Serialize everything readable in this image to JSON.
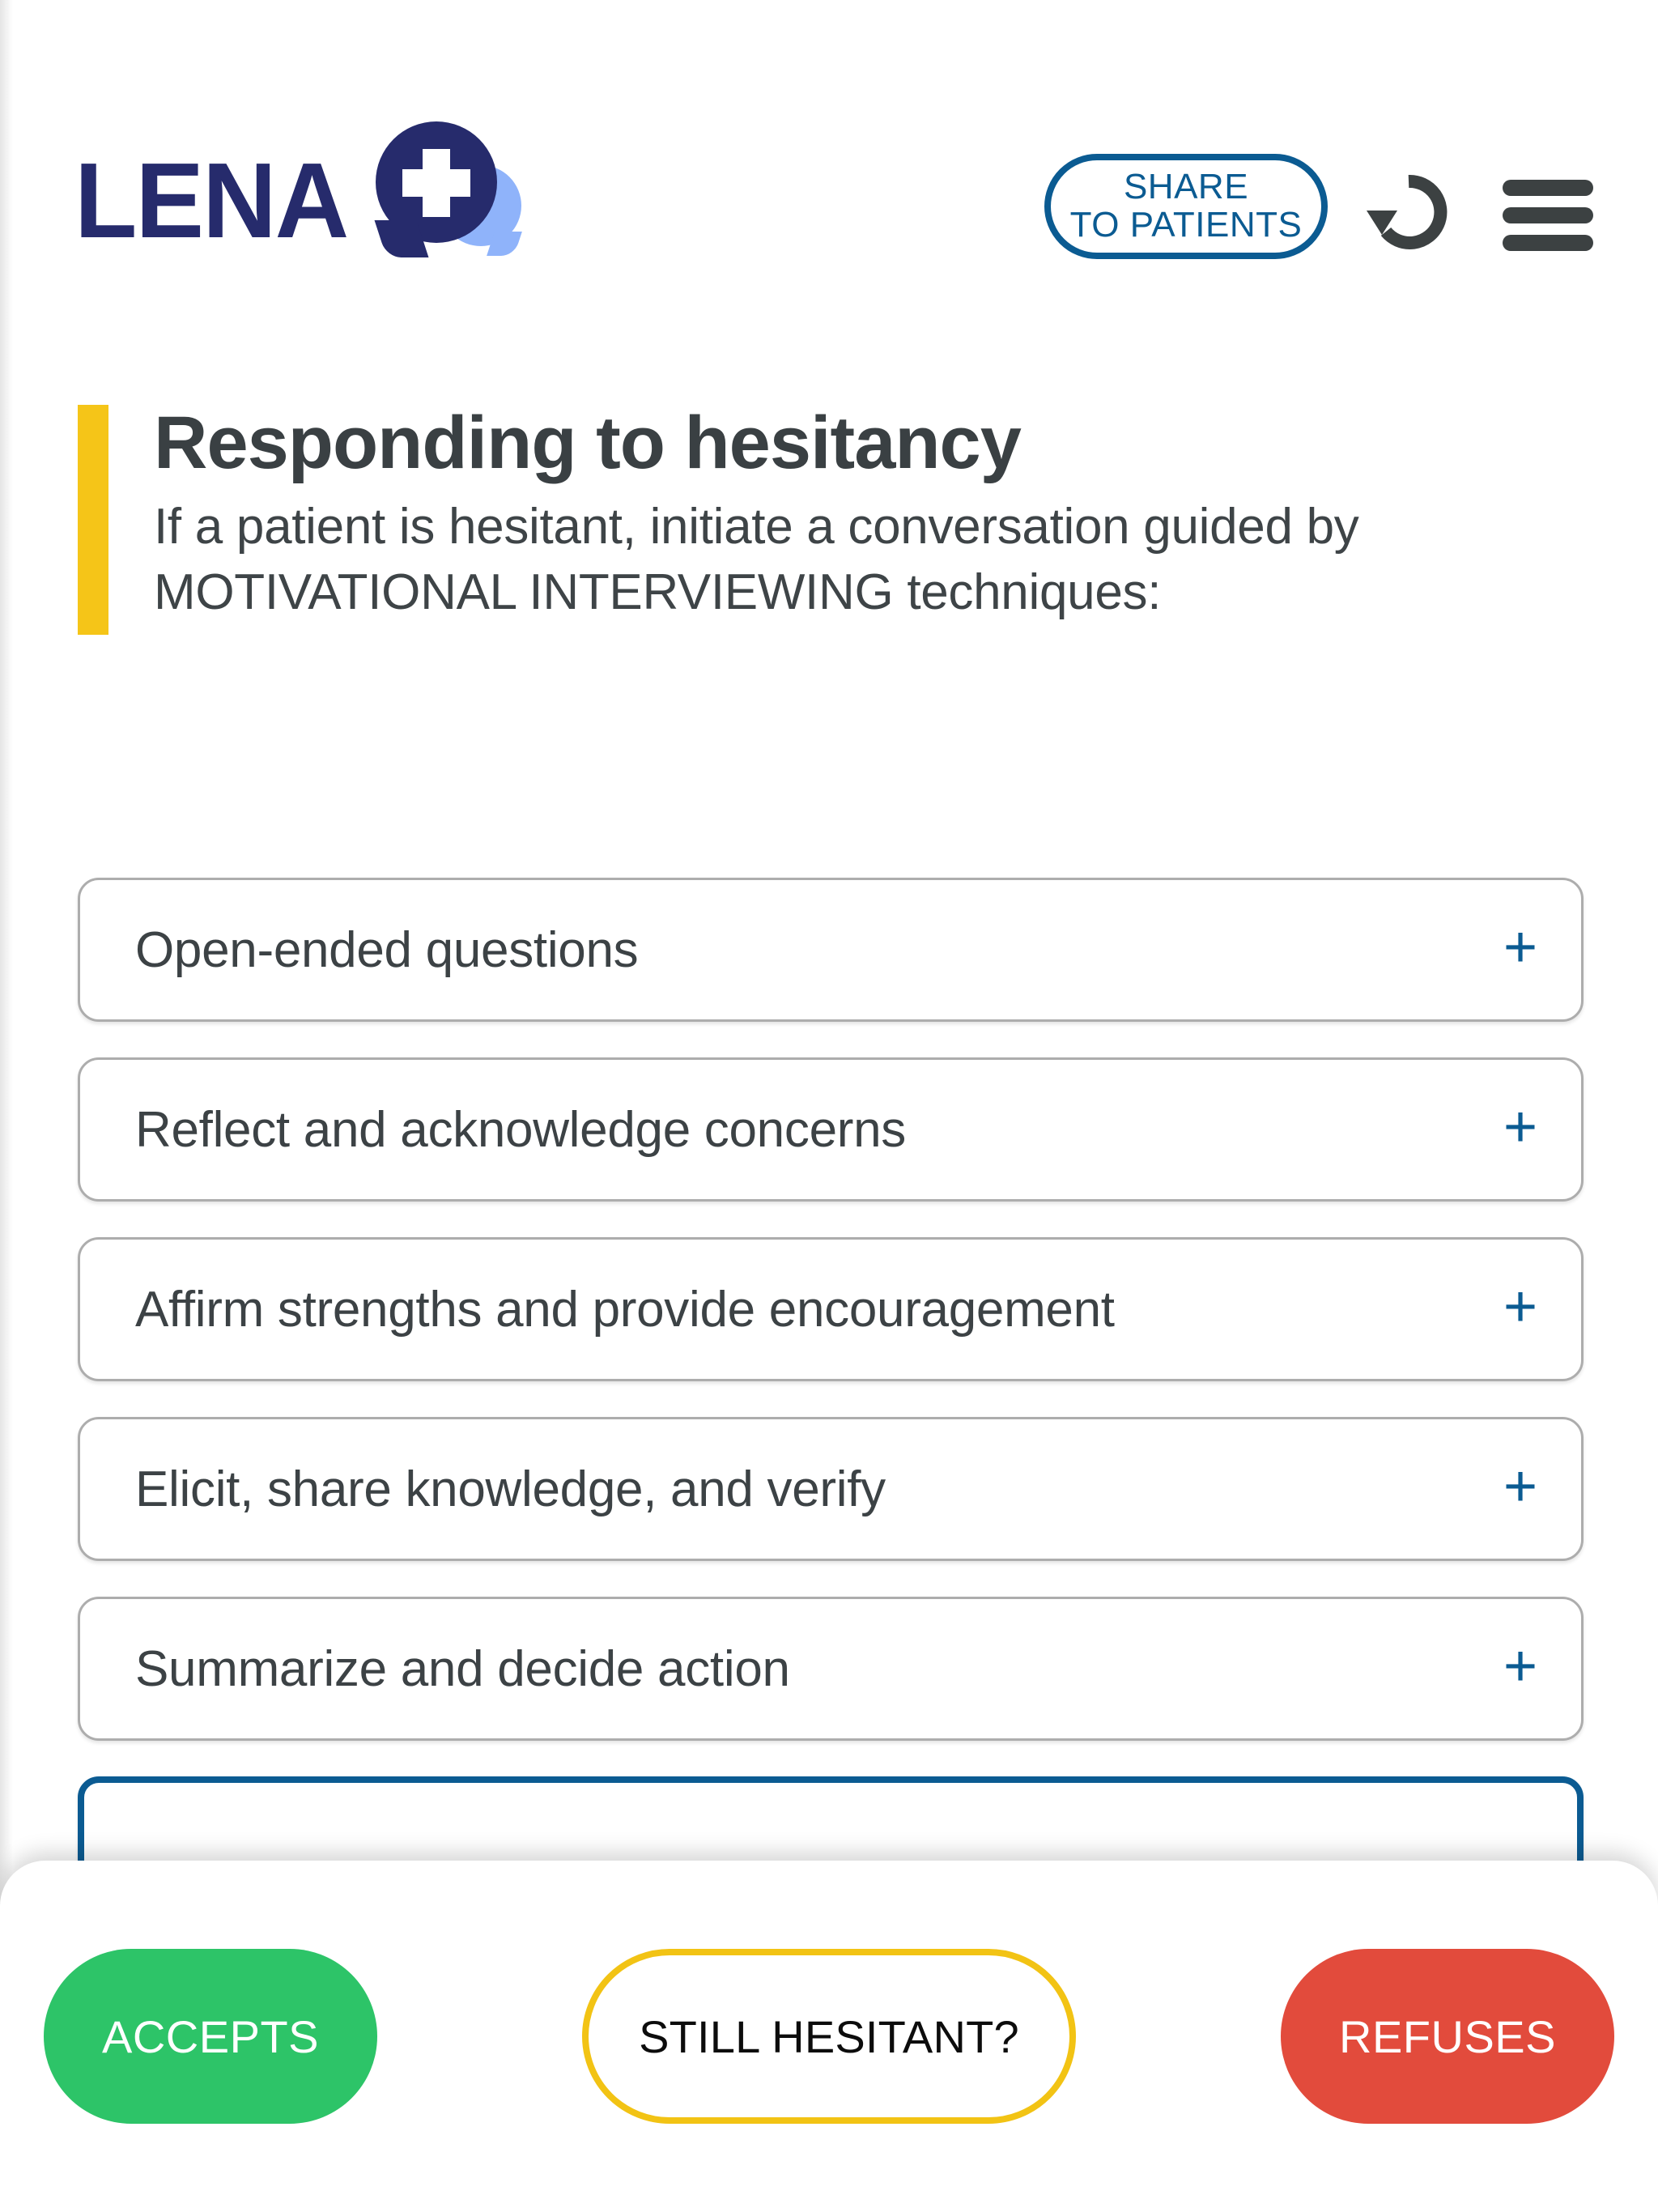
{
  "app": {
    "brand_name": "LENA",
    "brand_navy": "#262B6C",
    "brand_light_blue": "#8FB3FA",
    "accent_yellow": "#F5C518",
    "accent_blue": "#0B5B92",
    "text_dark": "#3C4245"
  },
  "header": {
    "logo_name": "LENA",
    "share_button": {
      "line1": "SHARE",
      "line2": "TO PATIENTS"
    },
    "restart_icon": "restart-arrow-icon",
    "menu_icon": "hamburger-menu-icon"
  },
  "title": {
    "heading": "Responding to hesitancy",
    "subtitle": "If a patient is hesitant, initiate a conversation guided by MOTIVATIONAL INTERVIEWING techniques:"
  },
  "accordion": {
    "expand_glyph": "+",
    "items": [
      {
        "label": "Open-ended questions"
      },
      {
        "label": "Reflect and acknowledge concerns"
      },
      {
        "label": "Affirm strengths and provide encouragement"
      },
      {
        "label": "Elicit, share knowledge, and verify"
      },
      {
        "label": "Summarize and decide action"
      },
      {
        "label": ""
      }
    ]
  },
  "bottom_bar": {
    "accepts_label": "ACCEPTS",
    "hesitant_label": "STILL HESITANT?",
    "refuses_label": "REFUSES",
    "accepts_color": "#2DC468",
    "hesitant_border_color": "#F2C314",
    "refuses_color": "#E24B3C"
  }
}
